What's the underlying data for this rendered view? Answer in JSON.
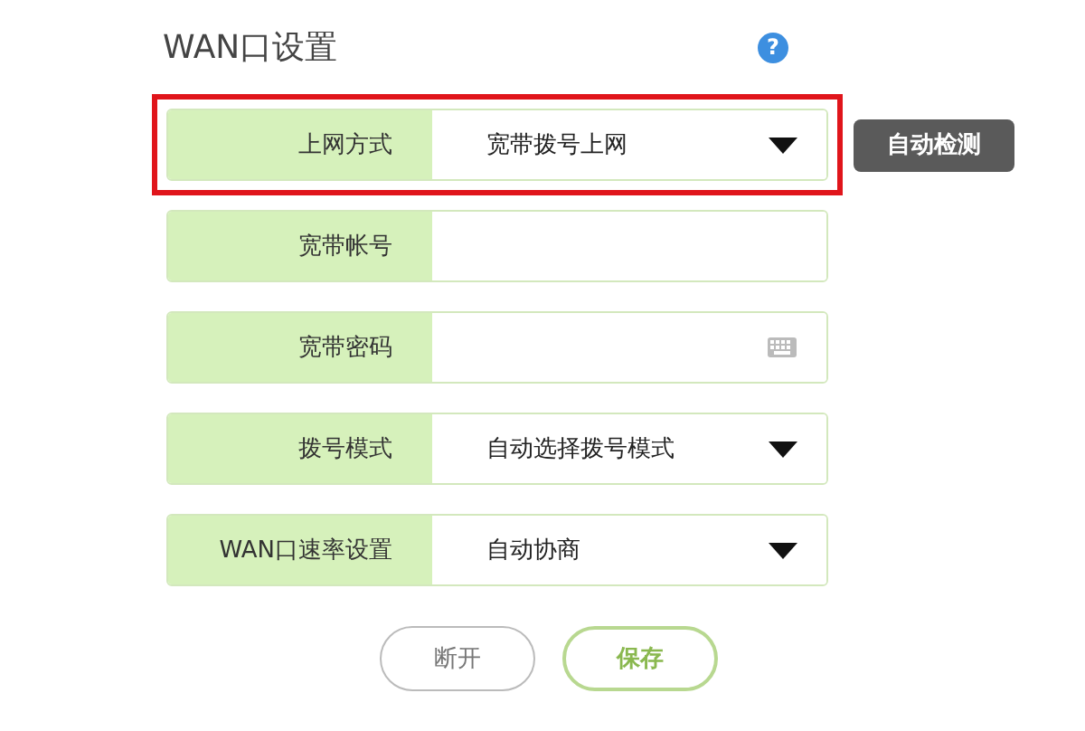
{
  "title": "WAN口设置",
  "help": "?",
  "fields": [
    {
      "kind": "select",
      "label": "上网方式",
      "value": "宽带拨号上网",
      "highlighted": true
    },
    {
      "kind": "text",
      "label": "宽带帐号",
      "highlighted": false
    },
    {
      "kind": "password",
      "label": "宽带密码",
      "highlighted": false
    },
    {
      "kind": "select",
      "label": "拨号模式",
      "value": "自动选择拨号模式",
      "highlighted": false
    },
    {
      "kind": "select",
      "label": "WAN口速率设置",
      "value": "自动协商",
      "highlighted": false
    }
  ],
  "auto_detect_button": "自动检测",
  "buttons": [
    {
      "kind": "secondary",
      "label": "断开"
    },
    {
      "kind": "primary",
      "label": "保存"
    }
  ]
}
